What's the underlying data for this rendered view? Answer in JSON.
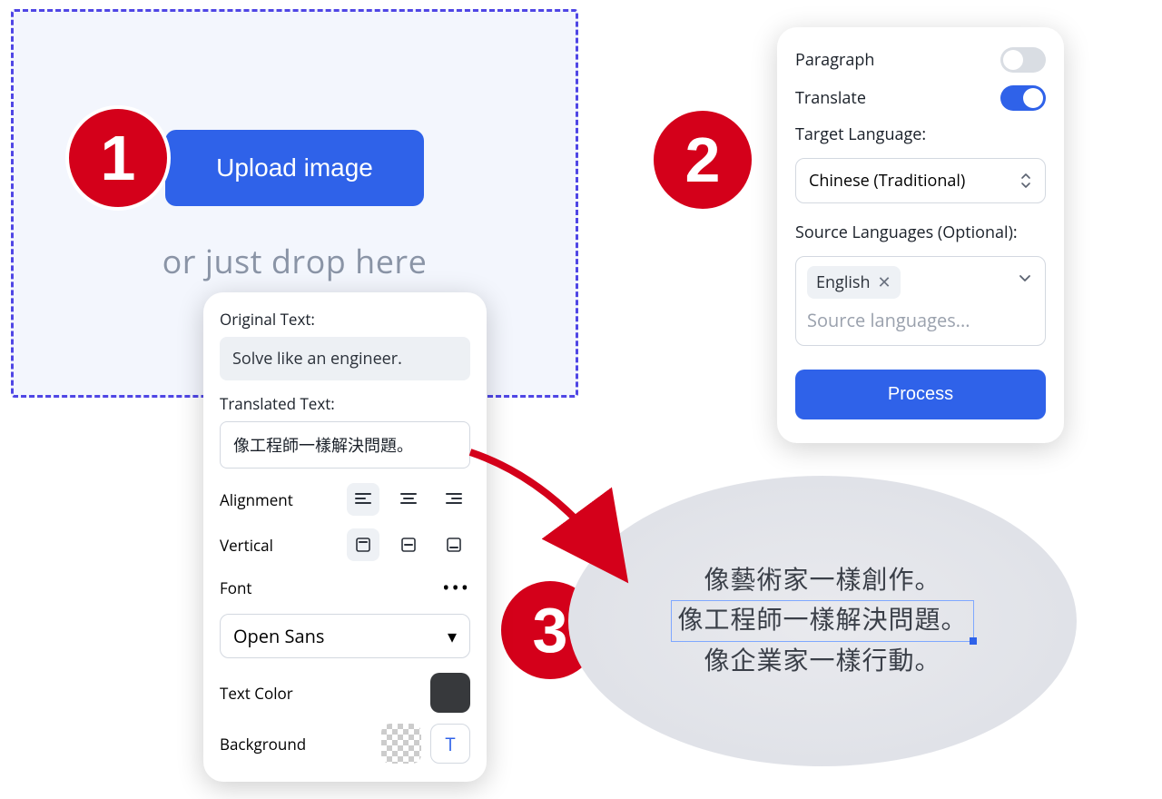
{
  "dropzone": {
    "button_label": "Upload image",
    "hint_text": "or just drop here"
  },
  "badges": {
    "one": "1",
    "two": "2",
    "three": "3"
  },
  "settings": {
    "paragraph_label": "Paragraph",
    "paragraph_on": false,
    "translate_label": "Translate",
    "translate_on": true,
    "target_label": "Target Language:",
    "target_value": "Chinese (Traditional)",
    "source_label": "Source Languages (Optional):",
    "source_chip": "English",
    "source_placeholder": "Source languages...",
    "process_label": "Process"
  },
  "edit": {
    "original_label": "Original Text:",
    "original_value": "Solve like an engineer.",
    "translated_label": "Translated Text:",
    "translated_value": "像工程師一樣解決問題。",
    "alignment_label": "Alignment",
    "vertical_label": "Vertical",
    "font_label": "Font",
    "font_value": "Open Sans",
    "text_color_label": "Text Color",
    "background_label": "Background",
    "bg_t_label": "T"
  },
  "result": {
    "line1": "像藝術家一樣創作。",
    "line2": "像工程師一樣解決問題。",
    "line3": "像企業家一樣行動。"
  }
}
